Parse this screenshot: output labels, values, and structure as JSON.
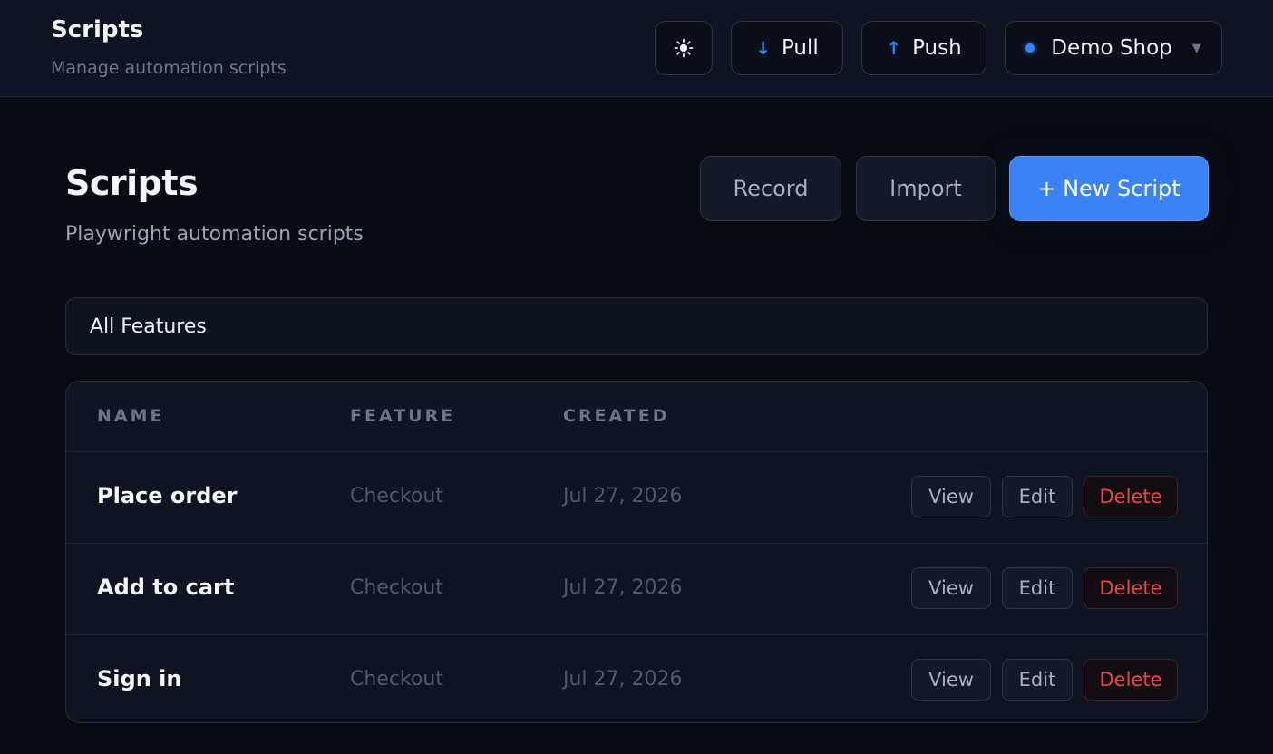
{
  "header": {
    "title": "Scripts",
    "subtitle": "Manage automation scripts",
    "theme_icon": "sun-icon",
    "pull_label": "Pull",
    "push_label": "Push",
    "workspace": "Demo Shop"
  },
  "page": {
    "title": "Scripts",
    "subtitle": "Playwright automation scripts",
    "record_label": "Record",
    "import_label": "Import",
    "new_label": "+ New Script"
  },
  "filter": {
    "value": "All Features"
  },
  "table": {
    "columns": {
      "name": "NAME",
      "feature": "FEATURE",
      "created": "CREATED"
    },
    "rows": [
      {
        "name": "Place order",
        "feature": "Checkout",
        "created": "Jul 27, 2026",
        "view": "View",
        "edit": "Edit",
        "delete": "Delete"
      },
      {
        "name": "Add to cart",
        "feature": "Checkout",
        "created": "Jul 27, 2026",
        "view": "View",
        "edit": "Edit",
        "delete": "Delete"
      },
      {
        "name": "Sign in",
        "feature": "Checkout",
        "created": "Jul 27, 2026",
        "view": "View",
        "edit": "Edit",
        "delete": "Delete"
      }
    ]
  },
  "colors": {
    "accent": "#3b82f6",
    "danger": "#ef4444",
    "background": "#080c14"
  }
}
